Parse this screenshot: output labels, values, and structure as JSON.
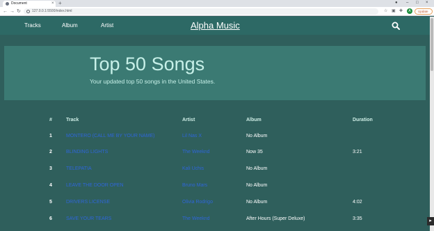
{
  "browser": {
    "tab_title": "Document",
    "tab_close": "×",
    "new_tab": "+",
    "url": "127.0.0.1:5500/index.html",
    "update_label": "Update",
    "profile_initial": "A",
    "minimize": "–",
    "maximize": "□",
    "close": "×",
    "back": "←",
    "forward": "→",
    "reload": "↻"
  },
  "nav": {
    "links": [
      "Tracks",
      "Album",
      "Artist"
    ],
    "brand": "Alpha Music"
  },
  "hero": {
    "title": "Top 50 Songs",
    "subtitle": "Your updated top 50 songs in the United States."
  },
  "table": {
    "headers": {
      "num": "#",
      "track": "Track",
      "artist": "Artist",
      "album": "Album",
      "duration": "Duration"
    },
    "rows": [
      {
        "num": "1",
        "track": "MONTERO (CALL ME BY YOUR NAME)",
        "artist": "Lil Nas X",
        "album": "No Album",
        "duration": ""
      },
      {
        "num": "2",
        "track": "BLINDING LIGHTS",
        "artist": "The Weeknd",
        "album": "Now 35",
        "duration": "3:21"
      },
      {
        "num": "3",
        "track": "TELEPATIA",
        "artist": "Kali Uchis",
        "album": "No Album",
        "duration": ""
      },
      {
        "num": "4",
        "track": "LEAVE THE DOOR OPEN",
        "artist": "Bruno Mars",
        "album": "No Album",
        "duration": ""
      },
      {
        "num": "5",
        "track": "DRIVERS LICENSE",
        "artist": "Olivia Rodrigo",
        "album": "No Album",
        "duration": "4:02"
      },
      {
        "num": "6",
        "track": "SAVE YOUR TEARS",
        "artist": "The Weeknd",
        "album": "After Hours (Super Deluxe)",
        "duration": "3:35"
      }
    ]
  },
  "colors": {
    "background": "#2f5f5c",
    "navbar": "#2d6965",
    "hero": "#3b7a73",
    "link": "#2f66d9",
    "hero_text": "#c7f0e8"
  }
}
